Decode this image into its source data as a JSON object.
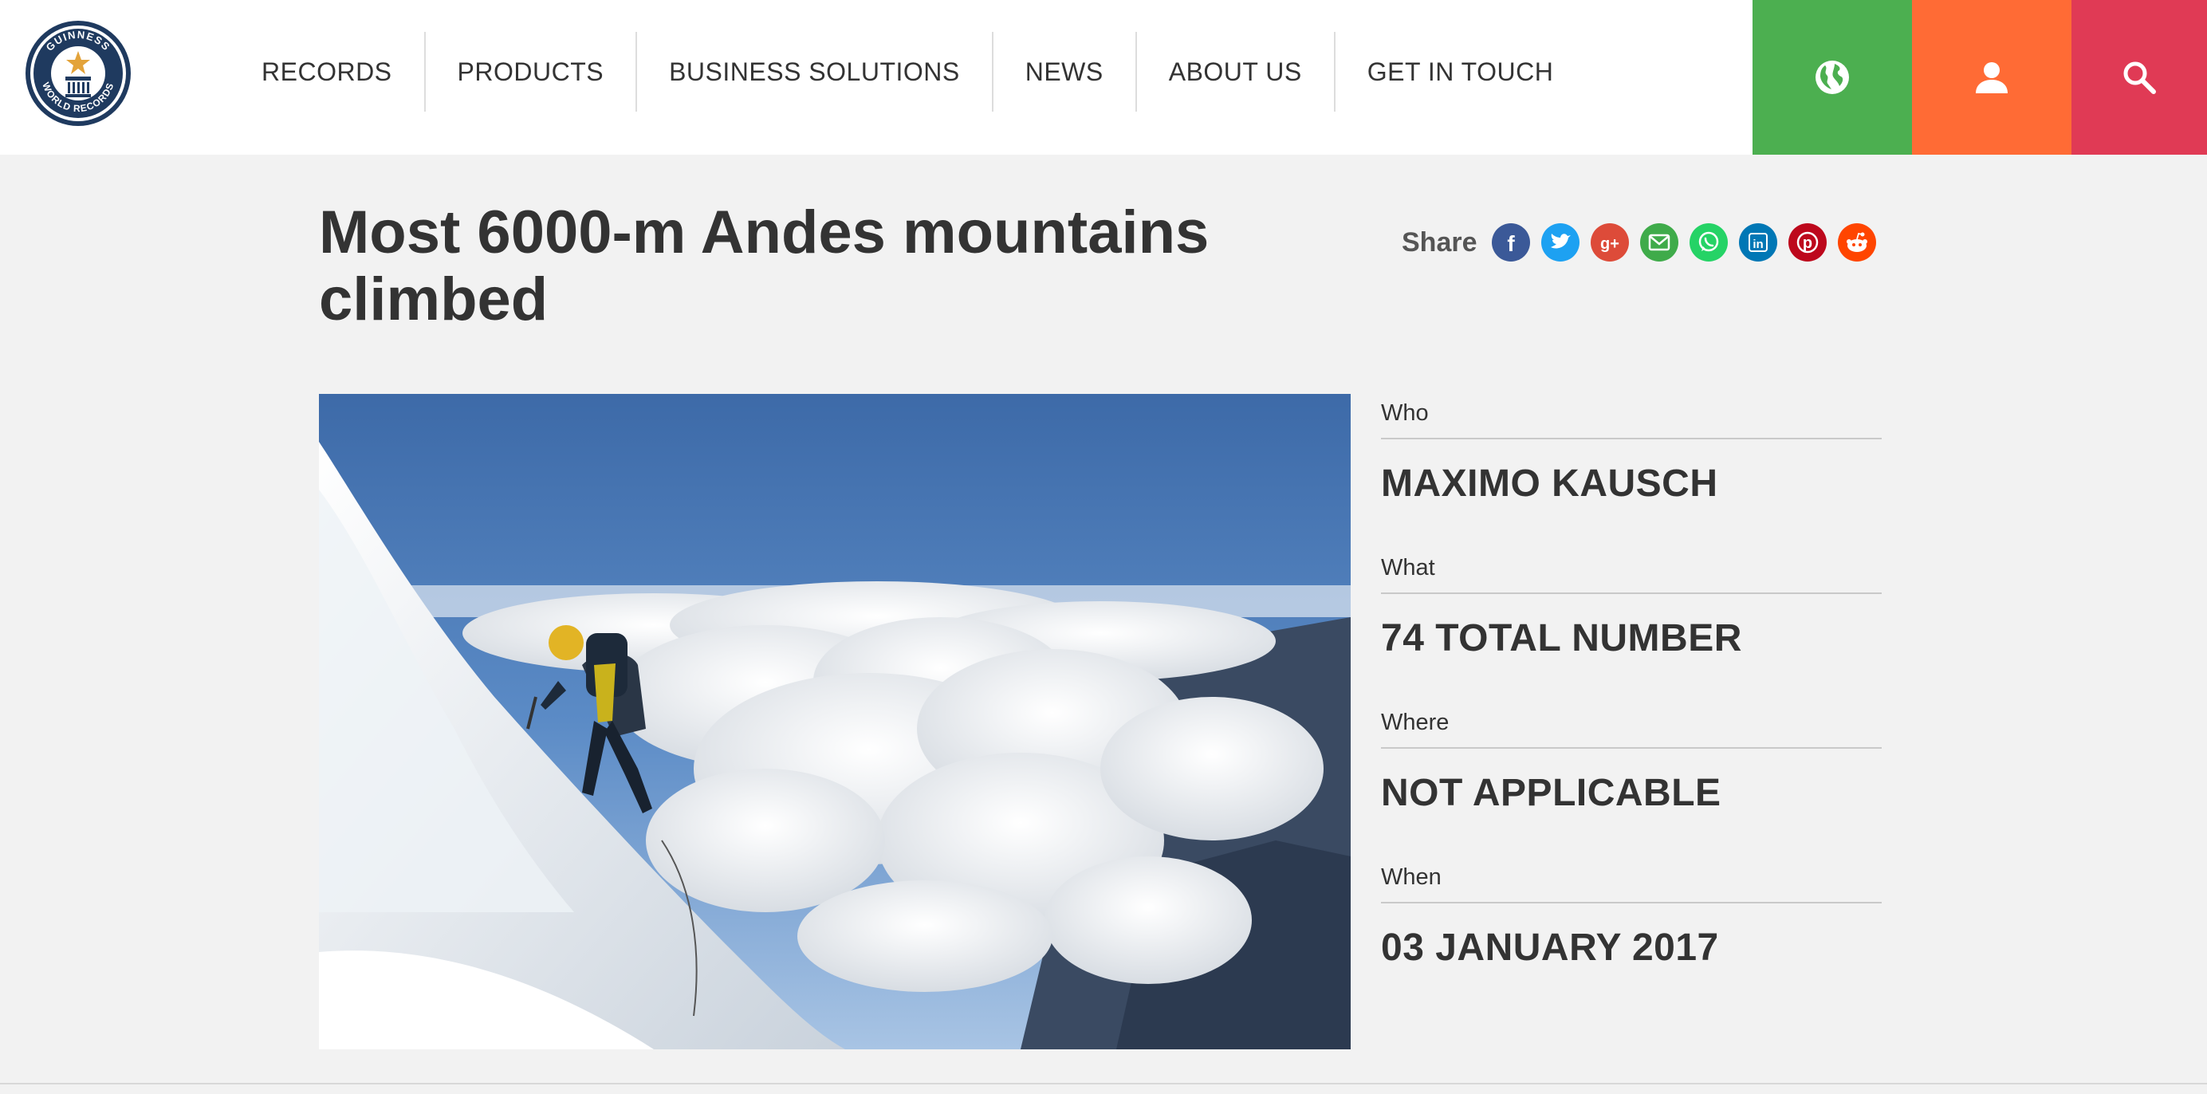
{
  "brand": {
    "name": "Guinness World Records",
    "logo_lines": [
      "GUINNESS",
      "WORLD RECORDS"
    ]
  },
  "nav": {
    "items": [
      {
        "label": "RECORDS"
      },
      {
        "label": "PRODUCTS"
      },
      {
        "label": "BUSINESS SOLUTIONS"
      },
      {
        "label": "NEWS"
      },
      {
        "label": "ABOUT US"
      },
      {
        "label": "GET IN TOUCH"
      }
    ]
  },
  "utility": {
    "globe": {
      "icon": "globe-icon",
      "color": "#4caf50"
    },
    "user": {
      "icon": "user-icon",
      "color": "#ff6b35"
    },
    "search": {
      "icon": "search-icon",
      "color": "#e03a55"
    }
  },
  "record": {
    "title": "Most 6000-m Andes mountains climbed"
  },
  "share": {
    "label": "Share",
    "networks": [
      {
        "name": "facebook",
        "icon": "facebook-icon",
        "color": "#3b5998",
        "glyph": "f"
      },
      {
        "name": "twitter",
        "icon": "twitter-icon",
        "color": "#1da1f2",
        "glyph": ""
      },
      {
        "name": "google-plus",
        "icon": "google-plus-icon",
        "color": "#dd4b39",
        "glyph": "g+"
      },
      {
        "name": "email",
        "icon": "email-icon",
        "color": "#3fab4a",
        "glyph": ""
      },
      {
        "name": "whatsapp",
        "icon": "whatsapp-icon",
        "color": "#25d366",
        "glyph": ""
      },
      {
        "name": "linkedin",
        "icon": "linkedin-icon",
        "color": "#0077b5",
        "glyph": "in"
      },
      {
        "name": "pinterest",
        "icon": "pinterest-icon",
        "color": "#bd081c",
        "glyph": "p"
      },
      {
        "name": "reddit",
        "icon": "reddit-icon",
        "color": "#ff4500",
        "glyph": ""
      }
    ]
  },
  "details": {
    "who_label": "Who",
    "who_value": "MAXIMO KAUSCH",
    "what_label": "What",
    "what_value": "74 TOTAL NUMBER",
    "where_label": "Where",
    "where_value": "NOT APPLICABLE",
    "when_label": "When",
    "when_value": "03 JANUARY 2017"
  }
}
